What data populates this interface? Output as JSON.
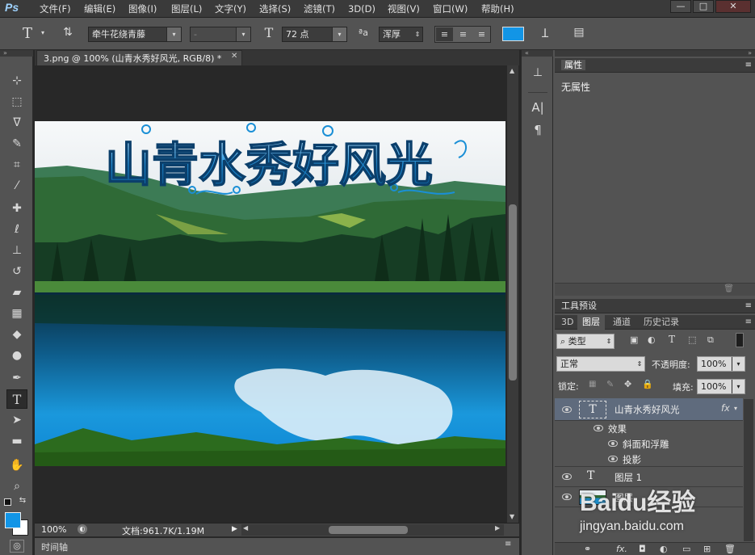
{
  "app": {
    "logo": "Ps"
  },
  "menu": [
    "文件(F)",
    "编辑(E)",
    "图像(I)",
    "图层(L)",
    "文字(Y)",
    "选择(S)",
    "滤镜(T)",
    "3D(D)",
    "视图(V)",
    "窗口(W)",
    "帮助(H)"
  ],
  "window_controls": {
    "minimize": "—",
    "restore": "□",
    "close": "✕"
  },
  "options": {
    "font_family": "牵牛花绕青藤",
    "font_style": "-",
    "font_size": "72 点",
    "aa_label": "ªa",
    "anti_alias": "浑厚",
    "text_color": "#1295e6"
  },
  "document": {
    "tab_title": "3.png @ 100% (山青水秀好风光, RGB/8) *",
    "headline": "山青水秀好风光"
  },
  "status": {
    "zoom": "100%",
    "doc_info": "文档:961.7K/1.19M"
  },
  "timeline": {
    "label": "时间轴"
  },
  "properties": {
    "title": "属性",
    "content": "无属性"
  },
  "tool_presets": {
    "title": "工具预设"
  },
  "layers_panel": {
    "tabs": [
      "3D",
      "图层",
      "通道",
      "历史记录"
    ],
    "filter_kind": "类型",
    "blend_mode": "正常",
    "opacity_label": "不透明度:",
    "opacity": "100%",
    "lock_label": "锁定:",
    "fill_label": "填充:",
    "fill": "100%",
    "layers": [
      {
        "name": "山青水秀好风光",
        "type": "T",
        "fx": "fx"
      },
      {
        "name": "效果"
      },
      {
        "name": "斜面和浮雕"
      },
      {
        "name": "投影"
      },
      {
        "name": "图层 1",
        "type": "T"
      },
      {
        "name": "图层"
      }
    ]
  },
  "watermark": {
    "brand": "Baidu经验",
    "url": "jingyan.baidu.com"
  }
}
